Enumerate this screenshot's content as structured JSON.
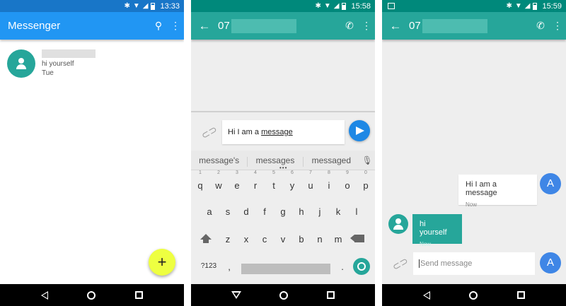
{
  "screens": {
    "list": {
      "status": {
        "time": "13:33"
      },
      "appbar": {
        "title": "Messenger",
        "search_icon": "search-icon",
        "menu_icon": "more-vert-icon"
      },
      "conversation": {
        "snippet": "hi yourself",
        "date": "Tue"
      },
      "fab_label": "+"
    },
    "compose": {
      "status": {
        "time": "15:58"
      },
      "appbar": {
        "contact": "07"
      },
      "input": {
        "text_plain": "Hi I am a ",
        "text_underlined": "message"
      },
      "suggestions": [
        "message's",
        "messages",
        "messaged"
      ],
      "keyboard": {
        "row1": [
          "q",
          "w",
          "e",
          "r",
          "t",
          "y",
          "u",
          "i",
          "o",
          "p"
        ],
        "row1_hints": [
          "1",
          "2",
          "3",
          "4",
          "5",
          "6",
          "7",
          "8",
          "9",
          "0"
        ],
        "row2": [
          "a",
          "s",
          "d",
          "f",
          "g",
          "h",
          "j",
          "k",
          "l"
        ],
        "row3": [
          "z",
          "x",
          "c",
          "v",
          "b",
          "n",
          "m"
        ],
        "symbols_key": "?123",
        "comma_key": ",",
        "period_key": "."
      }
    },
    "chat": {
      "status": {
        "time": "15:59"
      },
      "appbar": {
        "contact": "07"
      },
      "messages": [
        {
          "direction": "outgoing",
          "text": "Hi I am a message",
          "time": "Now",
          "avatar_letter": "A"
        },
        {
          "direction": "incoming",
          "text": "hi yourself",
          "time": "Now"
        }
      ],
      "input": {
        "placeholder": "Send message",
        "avatar_letter": "A"
      }
    }
  },
  "colors": {
    "messenger_blue": "#2196f3",
    "teal": "#26a69a",
    "fab_yellow": "#eeff41",
    "send_blue": "#1e88e5"
  }
}
